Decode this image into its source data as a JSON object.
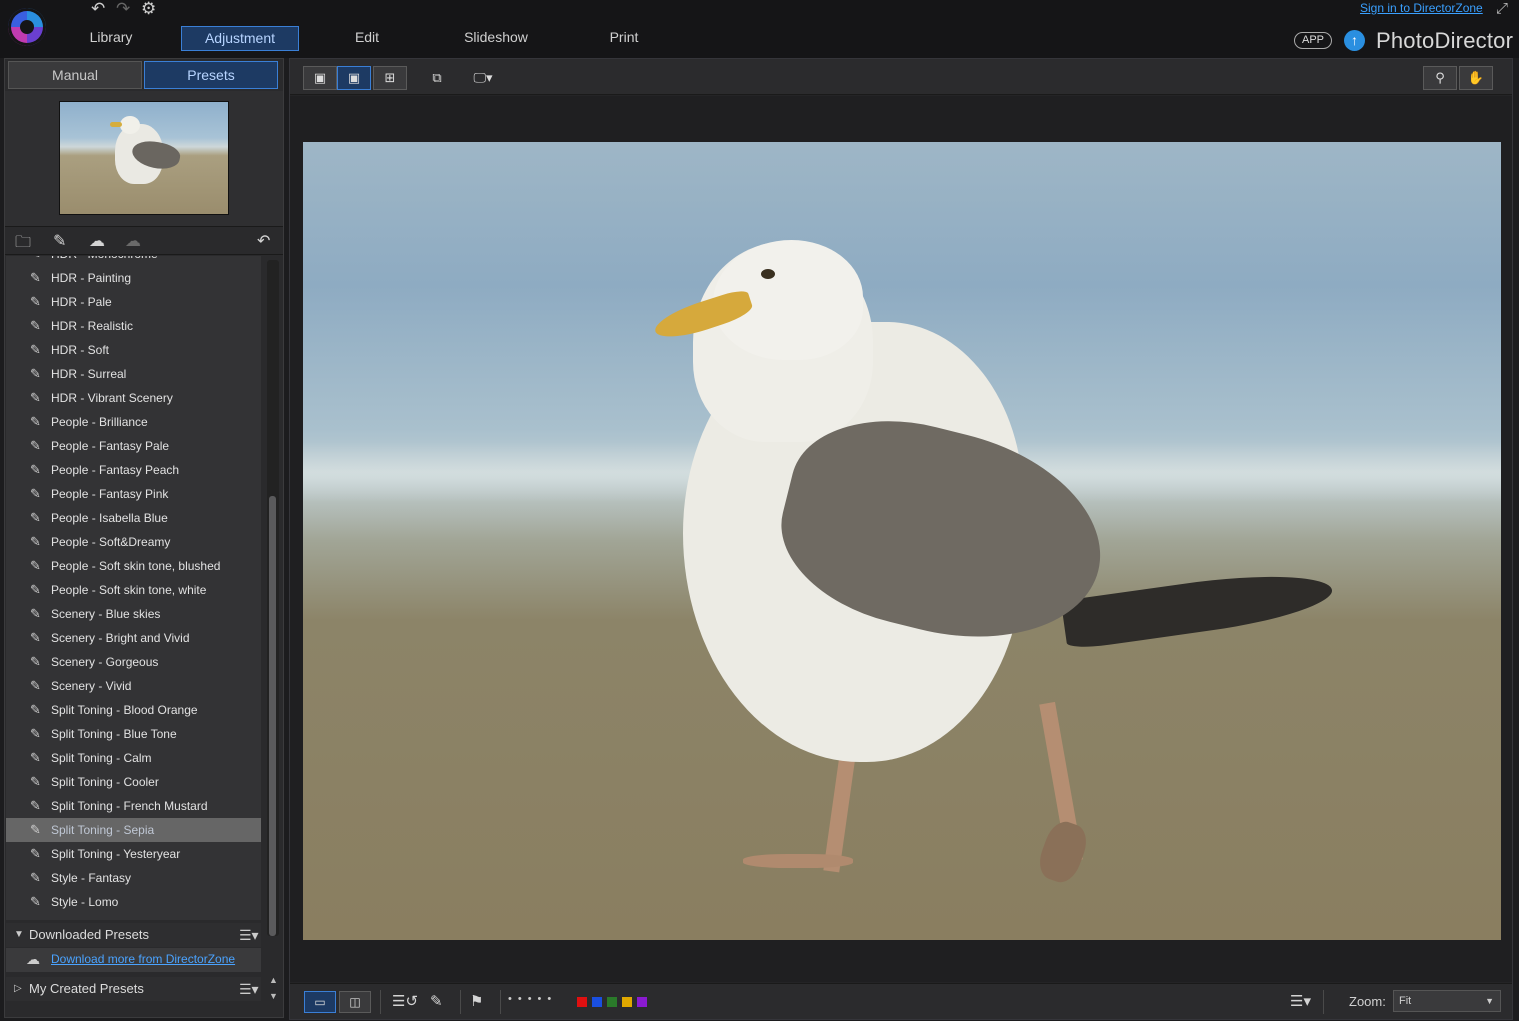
{
  "app": {
    "brand": "PhotoDirector",
    "app_badge": "APP",
    "signin_link": "Sign in to DirectorZone"
  },
  "modes": [
    {
      "label": "Library"
    },
    {
      "label": "Adjustment"
    },
    {
      "label": "Edit"
    },
    {
      "label": "Slideshow"
    },
    {
      "label": "Print"
    }
  ],
  "panel_tabs": {
    "manual": "Manual",
    "presets": "Presets"
  },
  "presets": [
    "HDR - Monochrome",
    "HDR - Painting",
    "HDR - Pale",
    "HDR - Realistic",
    "HDR - Soft",
    "HDR - Surreal",
    "HDR - Vibrant Scenery",
    "People - Brilliance",
    "People - Fantasy Pale",
    "People - Fantasy Peach",
    "People - Fantasy Pink",
    "People - Isabella Blue",
    "People - Soft&Dreamy",
    "People - Soft skin tone, blushed",
    "People - Soft skin tone, white",
    "Scenery - Blue skies",
    "Scenery - Bright and Vivid",
    "Scenery - Gorgeous",
    "Scenery - Vivid",
    "Split Toning - Blood Orange",
    "Split Toning - Blue Tone",
    "Split Toning - Calm",
    "Split Toning - Cooler",
    "Split Toning - French Mustard",
    "Split Toning - Sepia",
    "Split Toning - Yesteryear",
    "Style - Fantasy",
    "Style - Lomo"
  ],
  "selected_preset": "Split Toning - Sepia",
  "sections": {
    "downloaded": "Downloaded Presets",
    "download_link": "Download more from DirectorZone",
    "my_created": "My Created Presets"
  },
  "zoom": {
    "label": "Zoom:",
    "value": "Fit"
  },
  "colors": {
    "accent": "#3a7fd6",
    "link": "#4aa3ff",
    "labels": [
      "#e01010",
      "#1a4fe0",
      "#2a7a2a",
      "#e0a800",
      "#8a1ad0"
    ]
  }
}
